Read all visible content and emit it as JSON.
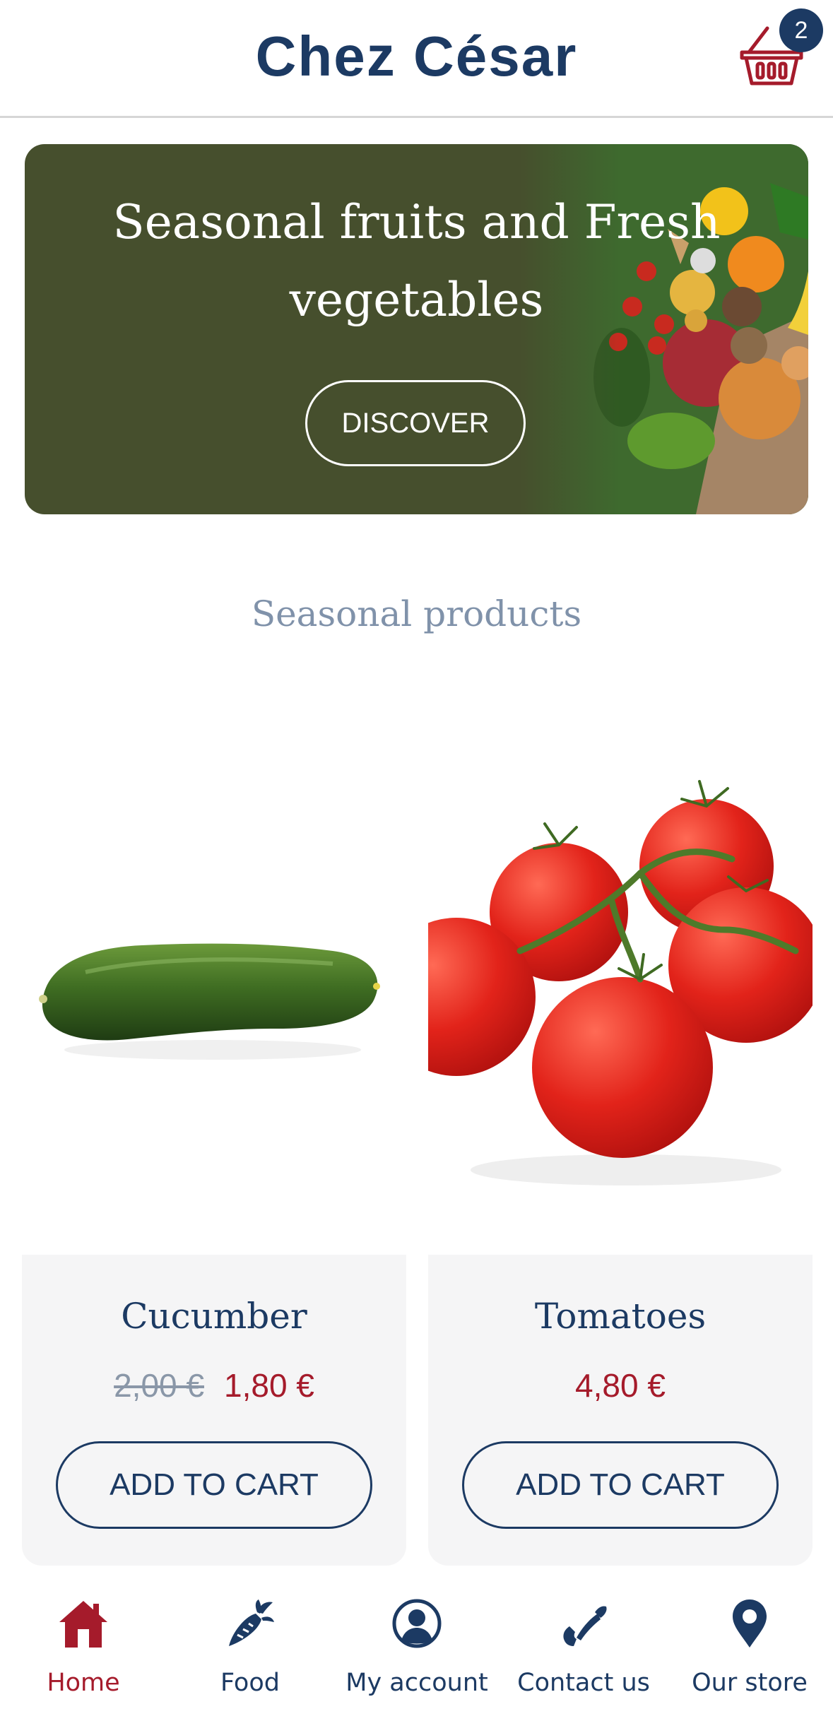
{
  "header": {
    "title": "Chez César",
    "cart_count": "2",
    "cart_icon": "basket-icon"
  },
  "hero": {
    "title_line1": "Seasonal fruits and Fresh",
    "title_line2": "vegetables",
    "button_label": "DISCOVER"
  },
  "section": {
    "title": "Seasonal products"
  },
  "products": [
    {
      "name": "Cucumber",
      "old_price": "2,00 €",
      "price": "1,80 €",
      "button_label": "ADD TO CART",
      "image": "cucumber-image"
    },
    {
      "name": "Tomatoes",
      "old_price": "",
      "price": "4,80 €",
      "button_label": "ADD TO CART",
      "image": "tomatoes-image"
    }
  ],
  "nav": {
    "items": [
      {
        "label": "Home",
        "icon": "home-icon",
        "active": true
      },
      {
        "label": "Food",
        "icon": "carrot-icon",
        "active": false
      },
      {
        "label": "My account",
        "icon": "user-icon",
        "active": false
      },
      {
        "label": "Contact us",
        "icon": "phone-icon",
        "active": false
      },
      {
        "label": "Our store",
        "icon": "map-pin-icon",
        "active": false
      }
    ]
  },
  "colors": {
    "brand": "#1c3a63",
    "accent": "#a51b2b",
    "hero_bg": "#464f2d",
    "card_bg": "#f5f5f6"
  }
}
